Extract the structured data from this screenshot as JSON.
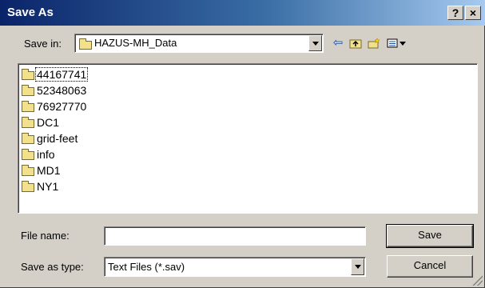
{
  "window": {
    "title": "Save As",
    "help_label": "?",
    "close_label": "×"
  },
  "toolbar": {
    "save_in_label": "Save in:",
    "save_in_value": "HAZUS-MH_Data",
    "icons": [
      "back-arrow-icon",
      "up-one-level-icon",
      "new-folder-icon",
      "view-menu-icon"
    ]
  },
  "file_list": {
    "items": [
      {
        "label": "44167741",
        "icon": "folder-icon",
        "selected": true
      },
      {
        "label": "52348063",
        "icon": "folder-icon"
      },
      {
        "label": "76927770",
        "icon": "folder-icon"
      },
      {
        "label": "DC1",
        "icon": "folder-icon"
      },
      {
        "label": "grid-feet",
        "icon": "folder-icon"
      },
      {
        "label": "info",
        "icon": "folder-icon"
      },
      {
        "label": "MD1",
        "icon": "folder-icon"
      },
      {
        "label": "NY1",
        "icon": "folder-icon"
      }
    ]
  },
  "form": {
    "file_name_label": "File name:",
    "file_name_value": "",
    "save_as_type_label": "Save as type:",
    "save_as_type_value": "Text Files (*.sav)"
  },
  "buttons": {
    "save_label": "Save",
    "cancel_label": "Cancel"
  },
  "colors": {
    "title_bar_start": "#0a246a",
    "title_bar_end": "#a6caf0",
    "dialog_face": "#d4d0c8"
  }
}
